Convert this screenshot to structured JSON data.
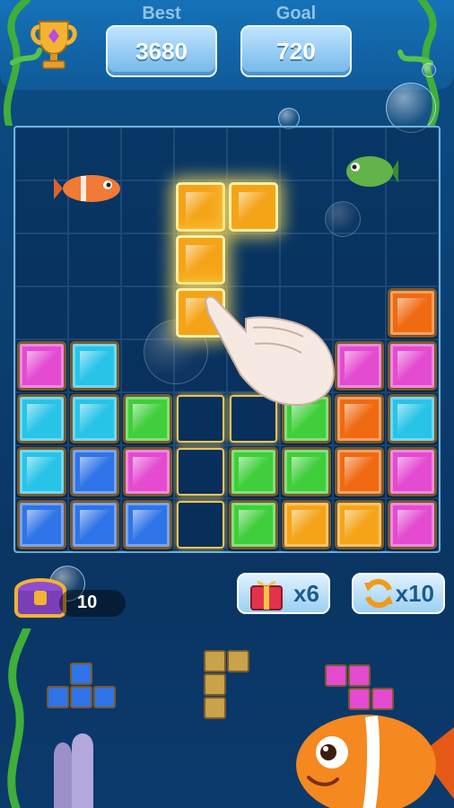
{
  "header": {
    "best_label": "Best",
    "best_value": "3680",
    "goal_label": "Goal",
    "goal_value": "720",
    "trophy_icon": "trophy-icon"
  },
  "board": {
    "size": 8,
    "gems": [
      {
        "r": 1,
        "c": 3,
        "color": "orange"
      },
      {
        "r": 1,
        "c": 4,
        "color": "orange"
      },
      {
        "r": 2,
        "c": 3,
        "color": "orange"
      },
      {
        "r": 3,
        "c": 3,
        "color": "orange"
      },
      {
        "r": 3,
        "c": 7,
        "color": "red"
      },
      {
        "r": 4,
        "c": 0,
        "color": "pink"
      },
      {
        "r": 4,
        "c": 1,
        "color": "cyan"
      },
      {
        "r": 4,
        "c": 6,
        "color": "pink"
      },
      {
        "r": 4,
        "c": 7,
        "color": "pink"
      },
      {
        "r": 5,
        "c": 0,
        "color": "cyan"
      },
      {
        "r": 5,
        "c": 1,
        "color": "cyan"
      },
      {
        "r": 5,
        "c": 2,
        "color": "green"
      },
      {
        "r": 5,
        "c": 5,
        "color": "green"
      },
      {
        "r": 5,
        "c": 6,
        "color": "red"
      },
      {
        "r": 5,
        "c": 7,
        "color": "cyan"
      },
      {
        "r": 6,
        "c": 0,
        "color": "cyan"
      },
      {
        "r": 6,
        "c": 1,
        "color": "blue"
      },
      {
        "r": 6,
        "c": 2,
        "color": "pink"
      },
      {
        "r": 6,
        "c": 4,
        "color": "green"
      },
      {
        "r": 6,
        "c": 5,
        "color": "green"
      },
      {
        "r": 6,
        "c": 6,
        "color": "red"
      },
      {
        "r": 6,
        "c": 7,
        "color": "pink"
      },
      {
        "r": 7,
        "c": 0,
        "color": "blue"
      },
      {
        "r": 7,
        "c": 1,
        "color": "blue"
      },
      {
        "r": 7,
        "c": 2,
        "color": "blue"
      },
      {
        "r": 7,
        "c": 4,
        "color": "green"
      },
      {
        "r": 7,
        "c": 5,
        "color": "orange"
      },
      {
        "r": 7,
        "c": 6,
        "color": "orange"
      },
      {
        "r": 7,
        "c": 7,
        "color": "pink"
      }
    ],
    "ghost_cells": [
      {
        "r": 5,
        "c": 3
      },
      {
        "r": 5,
        "c": 4
      },
      {
        "r": 6,
        "c": 3
      },
      {
        "r": 7,
        "c": 3
      }
    ],
    "glowing_piece": [
      {
        "r": 1,
        "c": 3
      },
      {
        "r": 1,
        "c": 4
      },
      {
        "r": 2,
        "c": 3
      },
      {
        "r": 3,
        "c": 3
      }
    ]
  },
  "colors": {
    "orange": "#f5a418",
    "red": "#f06a12",
    "pink": "#e44bd0",
    "cyan": "#27c4e8",
    "green": "#3fcf3a",
    "blue": "#2f74e8",
    "gold": "#c9a24a"
  },
  "bottom": {
    "chest_count": "10",
    "bomb_count": "x6",
    "refresh_count": "x10"
  },
  "tray": [
    {
      "id": "blue-t",
      "color": "blue",
      "cells": [
        {
          "x": 1,
          "y": 0
        },
        {
          "x": 0,
          "y": 1
        },
        {
          "x": 1,
          "y": 1
        },
        {
          "x": 2,
          "y": 1
        }
      ]
    },
    {
      "id": "gold-l",
      "color": "gold",
      "cells": [
        {
          "x": 0,
          "y": 0
        },
        {
          "x": 1,
          "y": 0
        },
        {
          "x": 0,
          "y": 1
        },
        {
          "x": 0,
          "y": 2
        }
      ]
    },
    {
      "id": "pink-z",
      "color": "pink",
      "cells": [
        {
          "x": 0,
          "y": 0
        },
        {
          "x": 1,
          "y": 0
        },
        {
          "x": 1,
          "y": 1
        },
        {
          "x": 2,
          "y": 1
        }
      ]
    }
  ]
}
